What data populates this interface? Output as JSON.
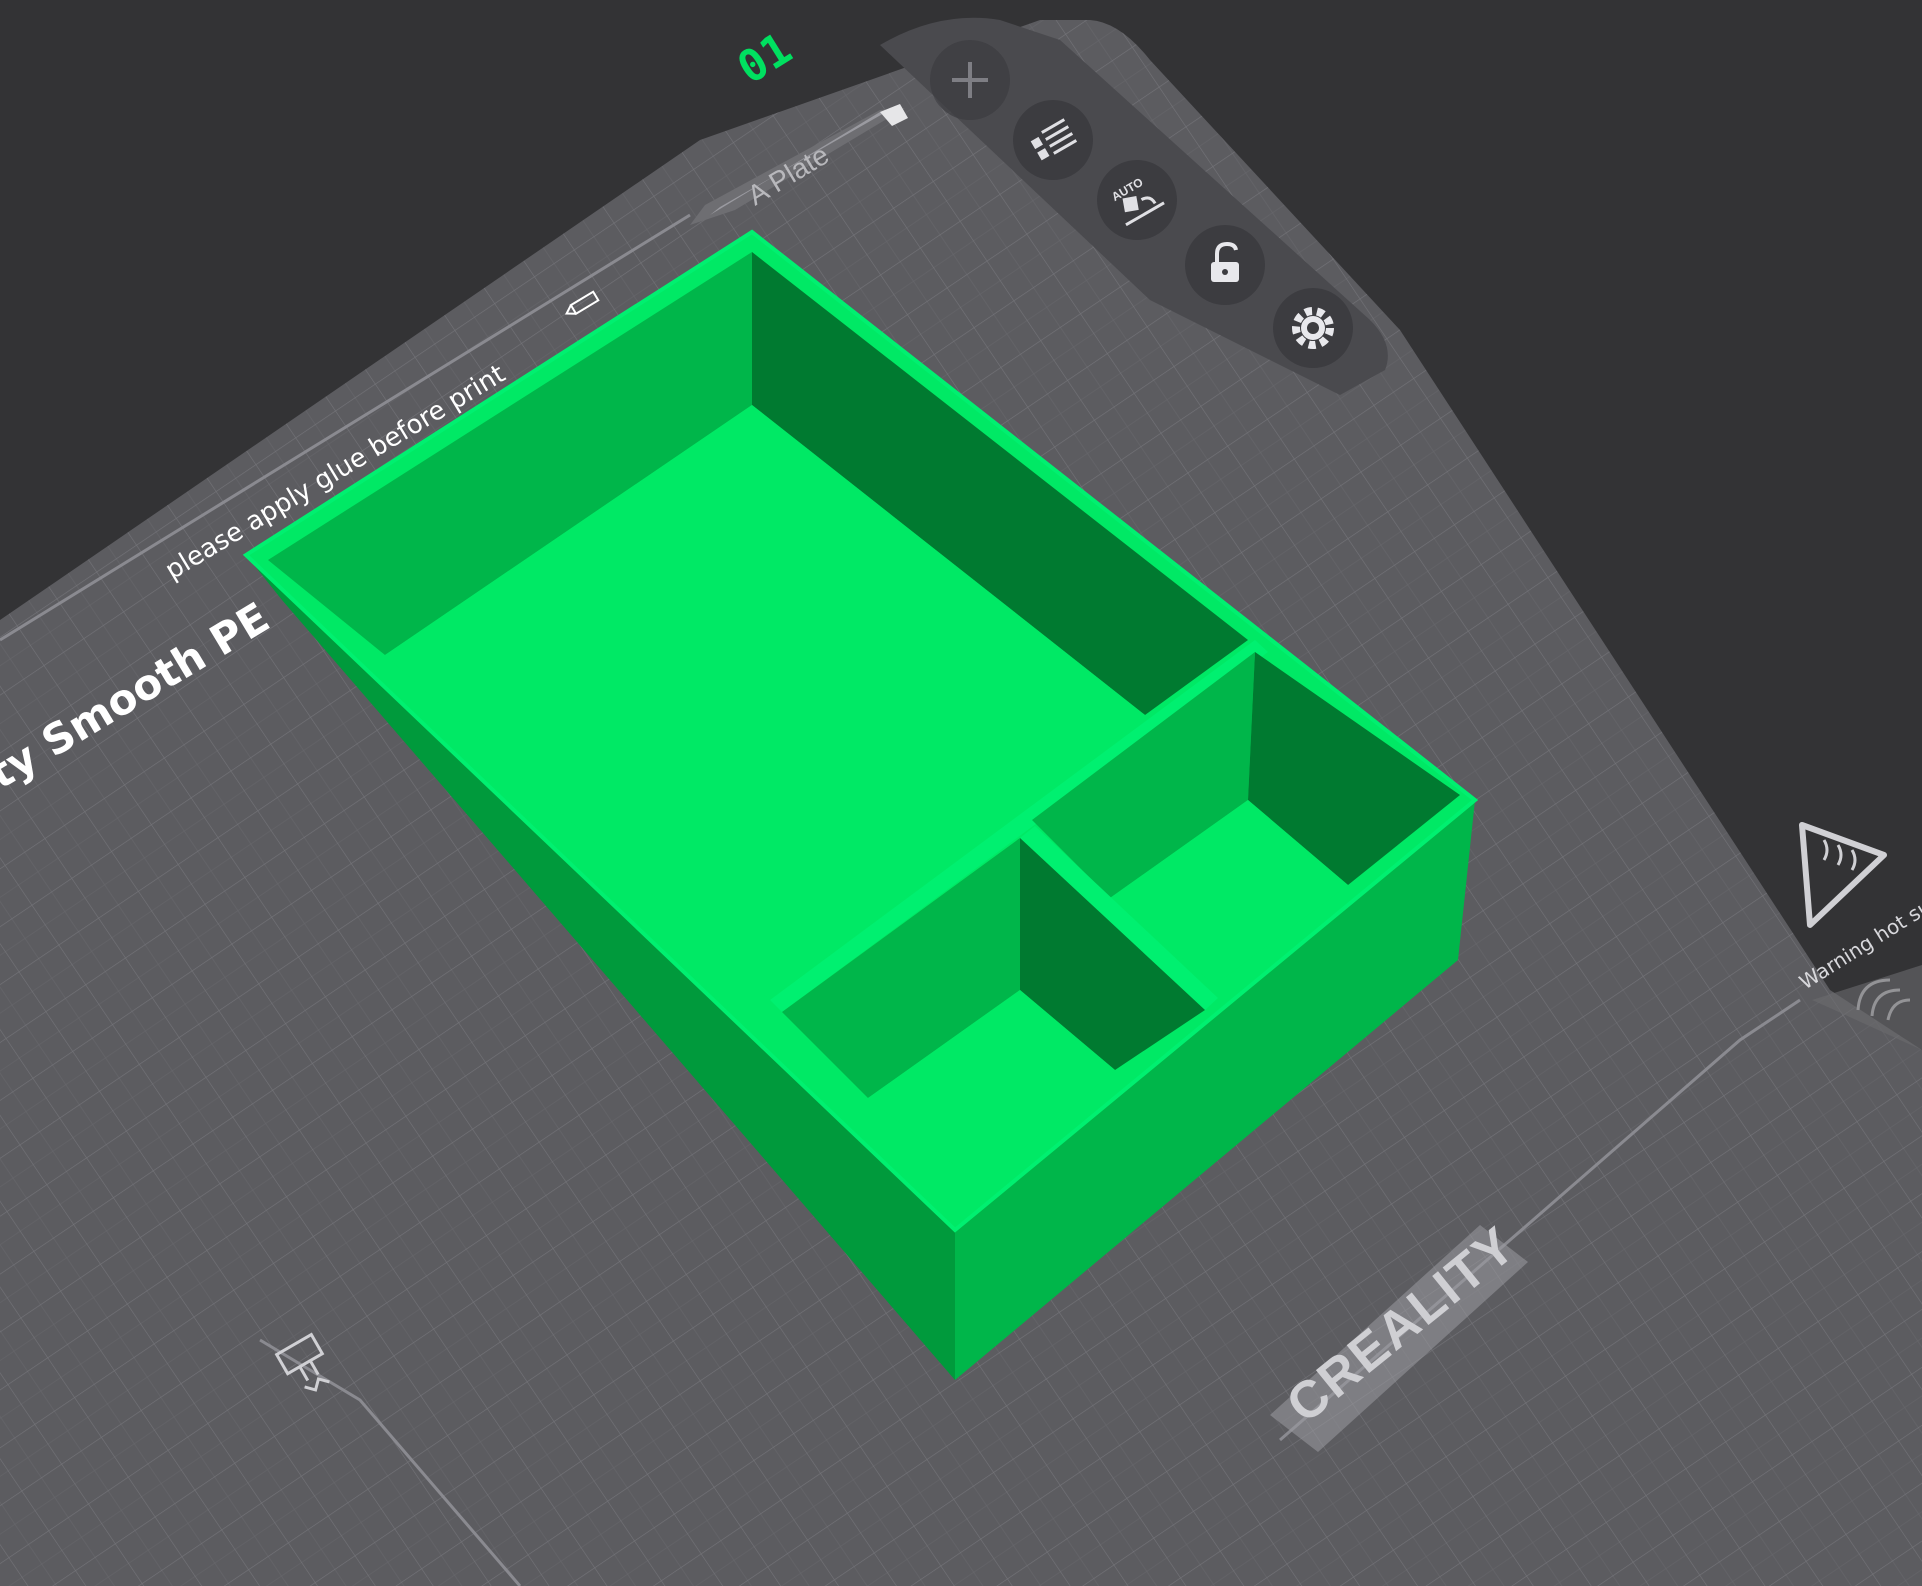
{
  "viewport": {
    "plate_number": "01",
    "plate_tab_label": "A Plate",
    "plate_note": "please apply glue before print",
    "plate_type_label": "ty Smooth PE",
    "brand_logo": "CREALITY",
    "warning_label": "Warning hot surface",
    "accent_color": "#00E060",
    "object_color": "#00E965"
  },
  "toolbar": {
    "items": [
      {
        "name": "add-plate-button",
        "icon": "plus-icon"
      },
      {
        "name": "arrange-list-button",
        "icon": "list-grid-icon"
      },
      {
        "name": "auto-orient-button",
        "icon": "auto-orient-icon",
        "label": "AUTO"
      },
      {
        "name": "lock-plate-button",
        "icon": "lock-icon"
      },
      {
        "name": "plate-settings-button",
        "icon": "gear-icon"
      }
    ]
  }
}
